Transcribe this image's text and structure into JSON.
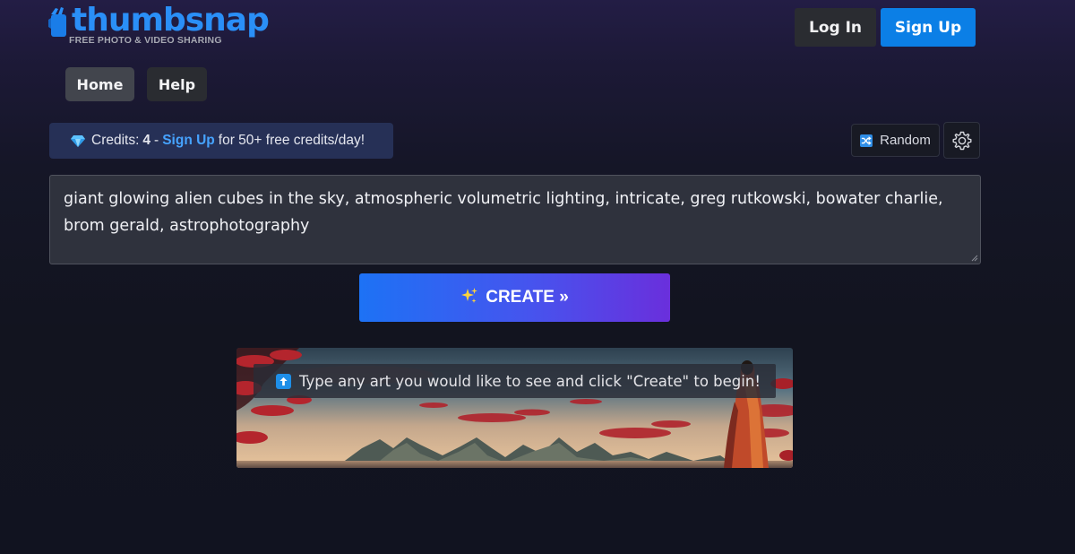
{
  "brand": {
    "name": "thumbsnap",
    "tagline": "FREE PHOTO & VIDEO SHARING"
  },
  "header": {
    "login_label": "Log In",
    "signup_label": "Sign Up"
  },
  "nav": {
    "tabs": [
      {
        "label": "Home",
        "active": true
      },
      {
        "label": "Help",
        "active": false
      }
    ]
  },
  "credits": {
    "prefix": "Credits:",
    "count": "4",
    "separator": "-",
    "signup_link": "Sign Up",
    "suffix": "for 50+ free credits/day!",
    "icon": "gem-icon"
  },
  "tools": {
    "random_label": "Random",
    "random_icon": "shuffle-icon",
    "settings_icon": "gear-icon"
  },
  "prompt": {
    "value": "giant glowing alien cubes in the sky, atmospheric volumetric lighting, intricate, greg rutkowski, bowater charlie, brom gerald, astrophotography"
  },
  "create": {
    "label": "CREATE »",
    "icon": "sparkles-icon"
  },
  "preview": {
    "hint": "Type any art you would like to see and click \"Create\" to begin!",
    "hint_icon": "up-arrow-icon"
  },
  "colors": {
    "accent": "#0b7fe6",
    "link": "#46a3ff",
    "create_start": "#1d72f5",
    "create_end": "#6a2fdc"
  }
}
